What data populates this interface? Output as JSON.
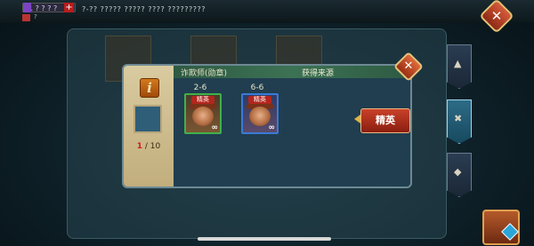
{
  "top_bar": {
    "resource_value": "1 ? ? ? ?",
    "plus_label": "+",
    "resource2_value": "?",
    "top_text": "?-?? ????? ????? ???? ?????????"
  },
  "close_top_label": "✕",
  "dialog": {
    "info_icon_label": "i",
    "hero_name": "诈欺师(勋章)",
    "source_title": "获得来源",
    "shard_current": "1",
    "shard_total": "/ 10",
    "sources": [
      {
        "stage": "2-6",
        "tag": "精英",
        "count": "∞",
        "color": "green"
      },
      {
        "stage": "6-6",
        "tag": "精英",
        "count": "∞",
        "color": "blue"
      }
    ],
    "elite_button": "精英",
    "close_label": "✕"
  },
  "colors": {
    "accent_close": "#c9412a",
    "header_green": "#3c7254",
    "card_green_border": "#42b04a",
    "card_blue_border": "#3a7ad6"
  }
}
